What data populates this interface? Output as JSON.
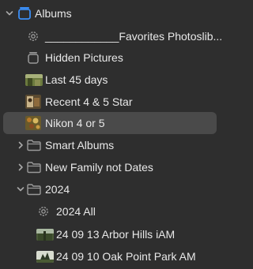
{
  "sidebar": {
    "root": {
      "label": "Albums",
      "icon": "albums-folder-icon",
      "expanded": true
    },
    "items": [
      {
        "label": "____________Favorites Photoslib...",
        "icon": "gear-icon",
        "kind": "smart-album"
      },
      {
        "label": "Hidden Pictures",
        "icon": "hidden-album-icon",
        "kind": "album"
      },
      {
        "label": "Last 45 days",
        "icon": "album-thumbnail",
        "kind": "album"
      },
      {
        "label": "Recent 4 & 5 Star",
        "icon": "album-thumbnail",
        "kind": "album"
      },
      {
        "label": "Nikon 4 or 5",
        "icon": "album-thumbnail",
        "kind": "album",
        "selected": true
      },
      {
        "label": "Smart Albums",
        "icon": "folder-icon",
        "kind": "folder",
        "expanded": false
      },
      {
        "label": "New Family not Dates",
        "icon": "folder-icon",
        "kind": "folder",
        "expanded": false
      },
      {
        "label": "2024",
        "icon": "folder-icon",
        "kind": "folder",
        "expanded": true
      },
      {
        "label": "2024 All",
        "icon": "gear-icon",
        "kind": "smart-album"
      },
      {
        "label": "24 09 13 Arbor Hills iAM",
        "icon": "album-thumbnail",
        "kind": "album"
      },
      {
        "label": "24 09 10 Oak Point Park AM",
        "icon": "album-thumbnail",
        "kind": "album"
      }
    ]
  },
  "colors": {
    "background": "#2e2e2e",
    "selection": "#4a4a4a",
    "text": "#e8e8e8",
    "icon_gray": "#9a9a9a",
    "accent_blue": "#3a8ef6"
  }
}
